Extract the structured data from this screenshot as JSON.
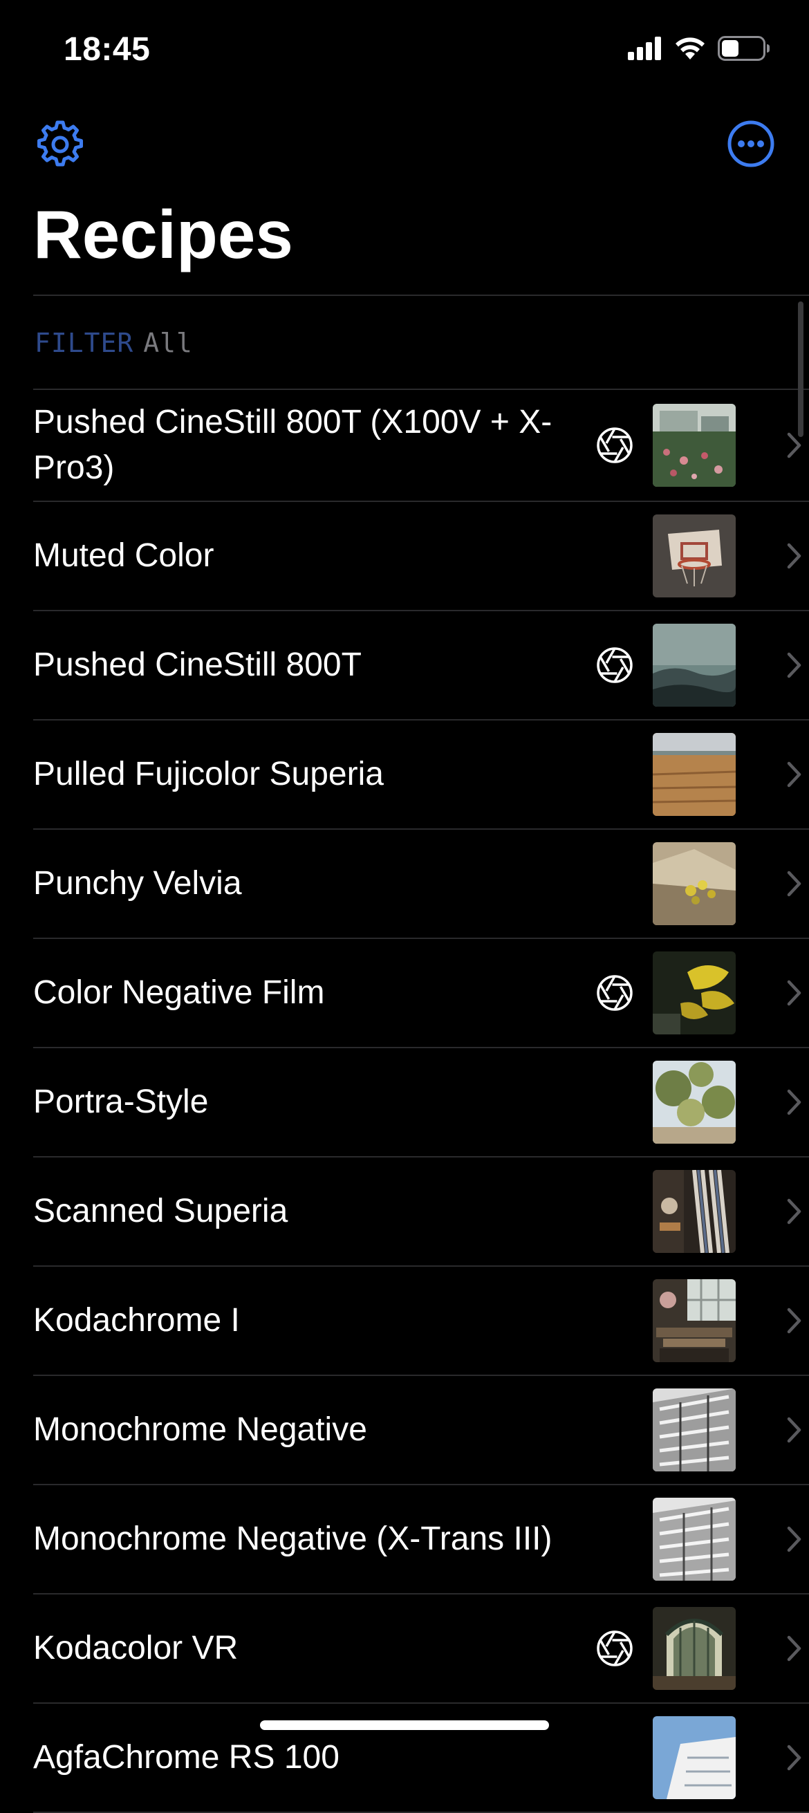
{
  "status_bar": {
    "time": "18:45"
  },
  "header": {
    "title": "Recipes",
    "settings_icon": "gear-icon",
    "more_icon": "ellipsis-circle-icon"
  },
  "filter": {
    "label": "FILTER",
    "value": "All"
  },
  "colors": {
    "accent": "#3d7cf0",
    "background": "#000000",
    "separator": "#2a2a2c",
    "filter_label": "#2e4a8c",
    "secondary_text": "#7a7a7e"
  },
  "recipes": [
    {
      "name": "Pushed CineStill 800T (X100V + X-Pro3)",
      "has_aperture": true,
      "thumb": "garden-flowers"
    },
    {
      "name": "Muted Color",
      "has_aperture": false,
      "thumb": "basketball-hoop"
    },
    {
      "name": "Pushed CineStill 800T",
      "has_aperture": true,
      "thumb": "misty-mountains"
    },
    {
      "name": "Pulled Fujicolor Superia",
      "has_aperture": false,
      "thumb": "golden-field"
    },
    {
      "name": "Punchy Velvia",
      "has_aperture": false,
      "thumb": "rock-flowers"
    },
    {
      "name": "Color Negative Film",
      "has_aperture": true,
      "thumb": "yellow-leaves"
    },
    {
      "name": "Portra-Style",
      "has_aperture": false,
      "thumb": "tree-sky"
    },
    {
      "name": "Scanned Superia",
      "has_aperture": false,
      "thumb": "interior-stripes"
    },
    {
      "name": "Kodachrome I",
      "has_aperture": false,
      "thumb": "window-books"
    },
    {
      "name": "Monochrome Negative",
      "has_aperture": false,
      "thumb": "bw-building"
    },
    {
      "name": "Monochrome Negative (X-Trans III)",
      "has_aperture": false,
      "thumb": "bw-building-2"
    },
    {
      "name": "Kodacolor VR",
      "has_aperture": true,
      "thumb": "arched-hall"
    },
    {
      "name": "AgfaChrome RS 100",
      "has_aperture": false,
      "thumb": "white-building"
    }
  ]
}
